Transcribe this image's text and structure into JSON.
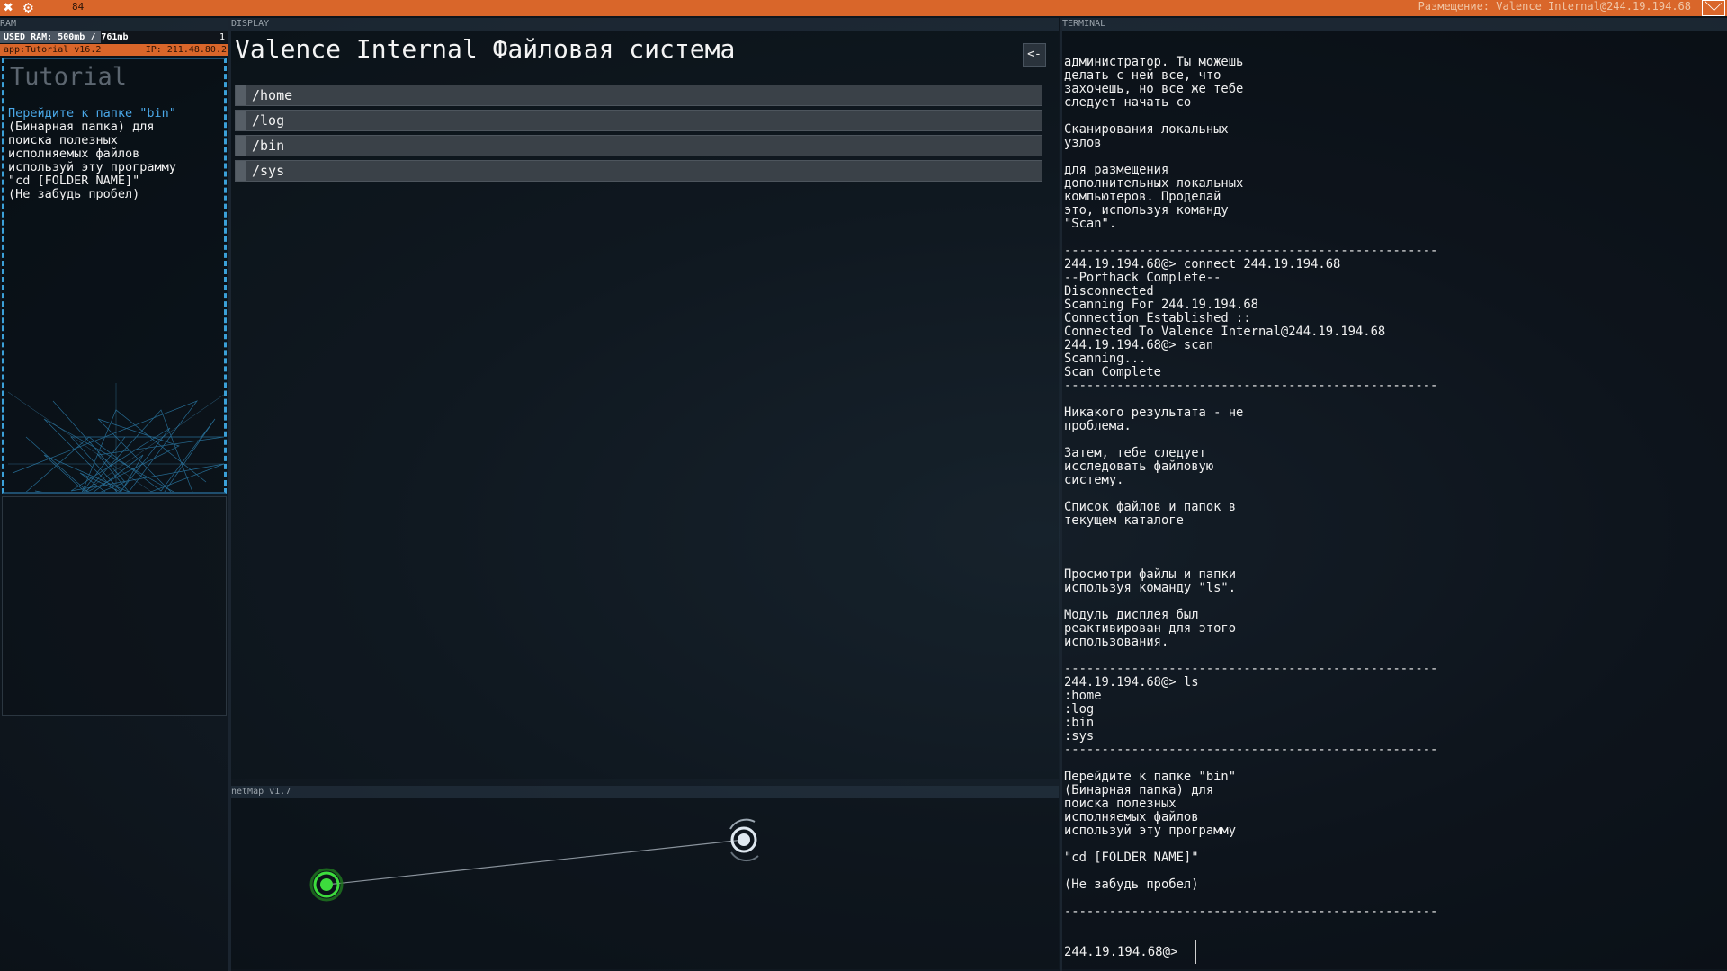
{
  "topbar": {
    "close_icon": "✖",
    "settings_icon": "⚙",
    "fps": "84",
    "location": "Размещение: Valence Internal@244.19.194.68"
  },
  "ram": {
    "label": "RAM",
    "usage_text": "USED RAM: 500mb / 761mb",
    "usage_fraction": 0.657,
    "count": "1",
    "app_name": "app:Tutorial v16.2",
    "ip": "IP: 211.48.80.2"
  },
  "tutorial": {
    "title": "Tutorial",
    "lines": [
      "Перейдите к папке \"bin\"",
      "(Бинарная папка) для",
      "поиска полезных",
      "исполняемых файлов",
      "используй эту программу",
      "",
      "\"cd [FOLDER NAME]\"",
      "(Не забудь пробел)"
    ]
  },
  "display": {
    "label": "DISPLAY",
    "title": "Valence Internal Файловая система",
    "back_label": "<-",
    "folders": [
      "/home",
      "/log",
      "/bin",
      "/sys"
    ]
  },
  "netmap": {
    "label": "netMap v1.7",
    "nodes": [
      {
        "name": "home-node",
        "color": "#3ddc3d"
      },
      {
        "name": "valence-internal-node",
        "color": "#dfe8f0"
      }
    ]
  },
  "terminal": {
    "label": "TERMINAL",
    "lines": [
      "администратор. Ты можешь",
      "делать с ней все, что",
      "захочешь, но все же тебе",
      "следует начать со",
      "",
      "Сканирования локальных",
      "узлов",
      "",
      "для размещения",
      "дополнительных локальных",
      "компьютеров. Проделай",
      "это, используя команду",
      "\"Scan\".",
      "",
      "--------------------------------------------------",
      "244.19.194.68@> connect 244.19.194.68",
      "--Porthack Complete--",
      "Disconnected",
      "Scanning For 244.19.194.68",
      "Connection Established ::",
      "Connected To Valence Internal@244.19.194.68",
      "244.19.194.68@> scan",
      "Scanning...",
      "Scan Complete",
      "--------------------------------------------------",
      "",
      "Никакого результата - не",
      "проблема.",
      "",
      "Затем, тебе следует",
      "исследовать файловую",
      "систему.",
      "",
      "Список файлов и папок в",
      "текущем каталоге",
      "",
      "",
      "",
      "Просмотри файлы и папки",
      "используя команду \"ls\".",
      "",
      "Модуль дисплея был",
      "реактивирован для этого",
      "использования.",
      "",
      "--------------------------------------------------",
      "244.19.194.68@> ls",
      ":home",
      ":log",
      ":bin",
      ":sys",
      "--------------------------------------------------",
      "",
      "Перейдите к папке \"bin\"",
      "(Бинарная папка) для",
      "поиска полезных",
      "исполняемых файлов",
      "используй эту программу",
      "",
      "\"cd [FOLDER NAME]\"",
      "",
      "(Не забудь пробел)",
      "",
      "--------------------------------------------------"
    ],
    "prompt": "244.19.194.68@>"
  }
}
